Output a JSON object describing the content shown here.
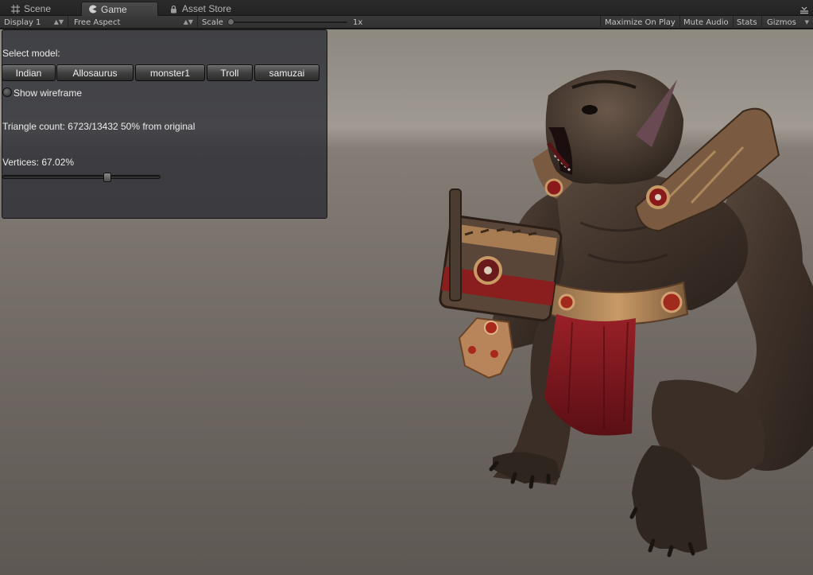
{
  "tabs": [
    {
      "label": "Scene",
      "icon": "grid-icon"
    },
    {
      "label": "Game",
      "icon": "pacman-icon"
    },
    {
      "label": "Asset Store",
      "icon": "lock-icon"
    }
  ],
  "toolbar": {
    "display": "Display 1",
    "aspect": "Free Aspect",
    "scale_label": "Scale",
    "scale_value": "1x",
    "maximize": "Maximize On Play",
    "mute": "Mute Audio",
    "stats": "Stats",
    "gizmos": "Gizmos"
  },
  "gui": {
    "select_model": "Select model:",
    "models": [
      "Indian",
      "Allosaurus",
      "monster1",
      "Troll",
      "samuzai"
    ],
    "show_wireframe": "Show wireframe",
    "show_wireframe_checked": false,
    "triangle_count": "Triangle count: 6723/13432 50% from original",
    "vertices": "Vertices: 67.02%",
    "vertices_fraction": 0.6702
  },
  "colors": {
    "editor_dark": "#2b2b2b",
    "panel_bg": "#22262e",
    "skin": "#4a3b30",
    "loincloth": "#8a1c22",
    "armor_gold": "#b88a55"
  }
}
